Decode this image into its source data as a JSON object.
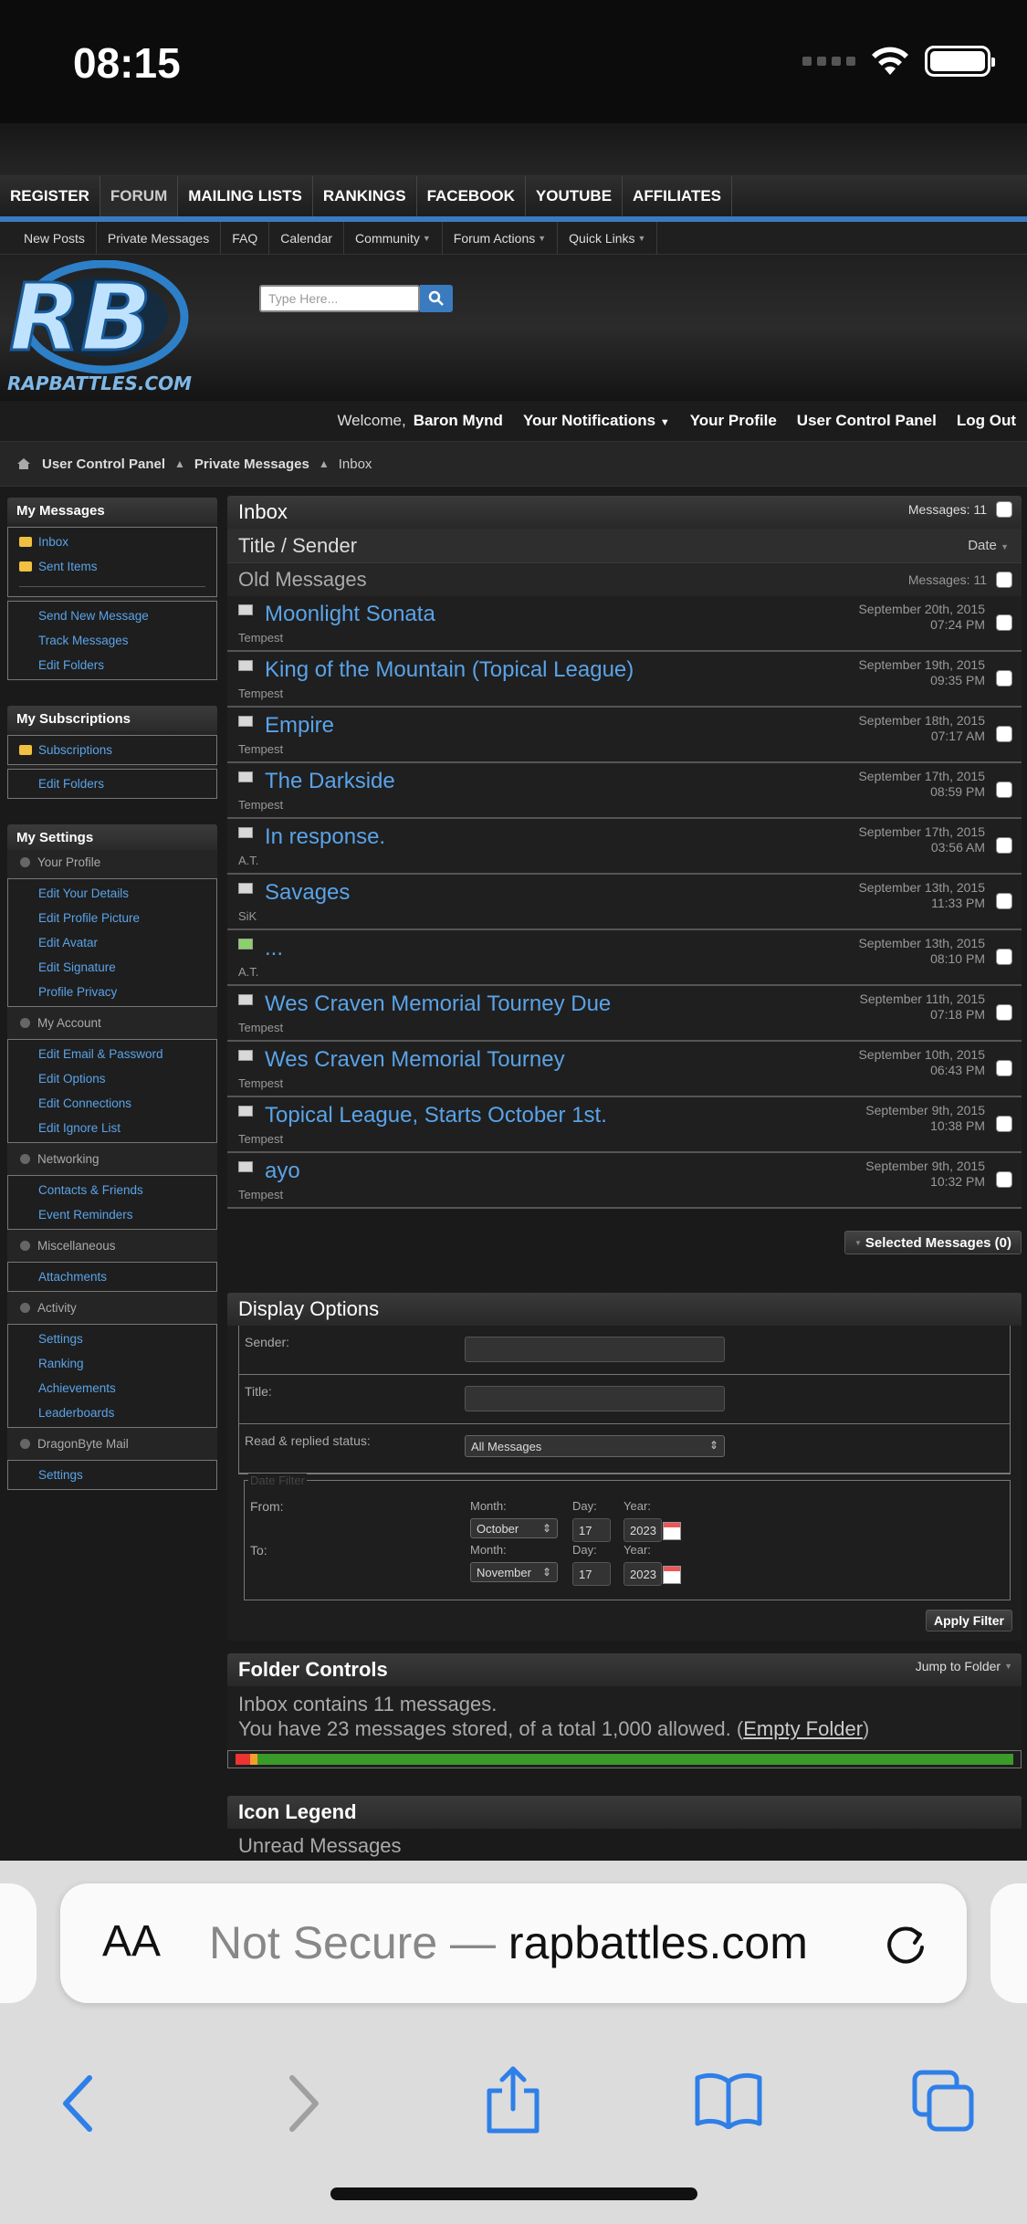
{
  "status": {
    "time": "08:15"
  },
  "nav": {
    "tabs": [
      "REGISTER",
      "FORUM",
      "MAILING LISTS",
      "RANKINGS",
      "FACEBOOK",
      "YOUTUBE",
      "AFFILIATES"
    ],
    "subnav": [
      "New Posts",
      "Private Messages",
      "FAQ",
      "Calendar",
      "Community",
      "Forum Actions",
      "Quick Links"
    ]
  },
  "banner": {
    "site_name": "RAPBATTLES.COM",
    "logo_text": "RB",
    "search_placeholder": "Type Here..."
  },
  "welcome": {
    "prefix": "Welcome,",
    "user": "Baron Mynd",
    "notifications": "Your Notifications",
    "profile": "Your Profile",
    "ucp": "User Control Panel",
    "logout": "Log Out"
  },
  "breadcrumb": [
    "User Control Panel",
    "Private Messages",
    "Inbox"
  ],
  "sidebar": {
    "my_messages": {
      "title": "My Messages",
      "folders": [
        "Inbox",
        "Sent Items"
      ],
      "actions": [
        "Send New Message",
        "Track Messages",
        "Edit Folders"
      ]
    },
    "my_subscriptions": {
      "title": "My Subscriptions",
      "folders": [
        "Subscriptions"
      ],
      "actions": [
        "Edit Folders"
      ]
    },
    "my_settings": {
      "title": "My Settings",
      "your_profile": "Your Profile",
      "profile_items": [
        "Edit Your Details",
        "Edit Profile Picture",
        "Edit Avatar",
        "Edit Signature",
        "Profile Privacy"
      ],
      "my_account": "My Account",
      "account_items": [
        "Edit Email & Password",
        "Edit Options",
        "Edit Connections",
        "Edit Ignore List"
      ],
      "networking": "Networking",
      "networking_items": [
        "Contacts & Friends",
        "Event Reminders"
      ],
      "misc": "Miscellaneous",
      "misc_items": [
        "Attachments"
      ],
      "activity": "Activity",
      "activity_items": [
        "Settings",
        "Ranking",
        "Achievements",
        "Leaderboards"
      ],
      "dragonbyte": "DragonByte Mail",
      "dragonbyte_items": [
        "Settings"
      ]
    }
  },
  "inbox": {
    "title": "Inbox",
    "count_label": "Messages: 11",
    "col_title": "Title / Sender",
    "col_date": "Date",
    "group_title": "Old Messages",
    "group_count": "Messages: 11",
    "messages": [
      {
        "title": "Moonlight Sonata",
        "sender": "Tempest",
        "date": "September 20th, 2015",
        "time": "07:24 PM"
      },
      {
        "title": "King of the Mountain (Topical League)",
        "sender": "Tempest",
        "date": "September 19th, 2015",
        "time": "09:35 PM"
      },
      {
        "title": "Empire",
        "sender": "Tempest",
        "date": "September 18th, 2015",
        "time": "07:17 AM"
      },
      {
        "title": "The Darkside",
        "sender": "Tempest",
        "date": "September 17th, 2015",
        "time": "08:59 PM"
      },
      {
        "title": "In response.",
        "sender": "A.T.",
        "date": "September 17th, 2015",
        "time": "03:56 AM"
      },
      {
        "title": "Savages",
        "sender": "SiK",
        "date": "September 13th, 2015",
        "time": "11:33 PM"
      },
      {
        "title": "...",
        "sender": "A.T.",
        "date": "September 13th, 2015",
        "time": "08:10 PM"
      },
      {
        "title": "Wes Craven Memorial Tourney Due",
        "sender": "Tempest",
        "date": "September 11th, 2015",
        "time": "07:18 PM"
      },
      {
        "title": "Wes Craven Memorial Tourney",
        "sender": "Tempest",
        "date": "September 10th, 2015",
        "time": "06:43 PM"
      },
      {
        "title": "Topical League, Starts October 1st.",
        "sender": "Tempest",
        "date": "September 9th, 2015",
        "time": "10:38 PM"
      },
      {
        "title": "ayo",
        "sender": "Tempest",
        "date": "September 9th, 2015",
        "time": "10:32 PM"
      }
    ],
    "selected_button": "Selected Messages (0)"
  },
  "display_options": {
    "title": "Display Options",
    "sender_label": "Sender:",
    "title_label": "Title:",
    "status_label": "Read & replied status:",
    "status_value": "All Messages",
    "date_filter": "Date Filter",
    "from_label": "From:",
    "to_label": "To:",
    "month_label": "Month:",
    "day_label": "Day:",
    "year_label": "Year:",
    "from_month": "October",
    "from_day": "17",
    "from_year": "2023",
    "to_month": "November",
    "to_day": "17",
    "to_year": "2023",
    "apply": "Apply Filter"
  },
  "folder_controls": {
    "title": "Folder Controls",
    "jump": "Jump to Folder",
    "line1": "Inbox contains 11 messages.",
    "line2_prefix": "You have 23 messages stored, of a total 1,000 allowed. (",
    "empty_link": "Empty Folder",
    "line2_suffix": ")",
    "usage_fraction": 0.023
  },
  "legend": {
    "title": "Icon Legend",
    "first_item": "Unread Messages"
  },
  "safari": {
    "aa": "AA",
    "not_secure": "Not Secure —",
    "domain": "rapbattles.com"
  }
}
